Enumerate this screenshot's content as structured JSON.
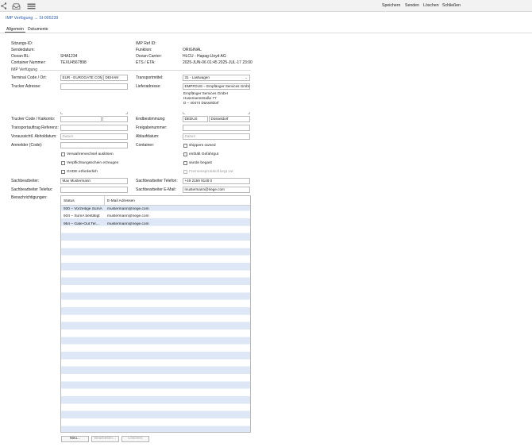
{
  "toolbar": {
    "actions": {
      "save": "Speichern",
      "send": "Senden",
      "delete": "Löschen",
      "close": "Schließen"
    }
  },
  "breadcrumb": "IMP Verfügung → SI-005239",
  "tabs": {
    "general": "Allgemein",
    "documents": "Dokumente"
  },
  "header_left": {
    "session_id_label": "Sitzungs-ID:",
    "send_date_label": "Sendedatum:",
    "ocean_bl_label": "Ocean BL:",
    "ocean_bl_value": "SHA1234",
    "container_no_label": "Container Nummer:",
    "container_no_value": "TEXU4567898"
  },
  "header_right": {
    "imp_ref_label": "IMP Ref ID:",
    "function_label": "Funktion:",
    "function_value": "ORIGINAL",
    "carrier_label": "Ocean Carrier:",
    "carrier_value": "HLCU - Hapag-Lloyd AG",
    "ets_label": "ETS / ETA:",
    "ets_value": "2025-JUN-06 01:45  2025-JUL-17 23:00"
  },
  "section_title": "IMP Verfügung",
  "form": {
    "terminal_label": "Terminal Code / Ort:",
    "terminal_code": "EUR - EUROGATE COM",
    "terminal_place": "DEHAM",
    "trucker_address_label": "Trucker Adresse:",
    "trucker_code_label": "Trucker Code / Kaikonto:",
    "transport_ref_label": "Transportauftrag Referenz:",
    "pickup_label": "Voraussichtl. Abholdatum:",
    "pickup_placeholder": "Datum",
    "notifier_label": "Anmelder (Code):",
    "transport_label": "Transportmittel:",
    "transport_value": "31 - Lastwagen",
    "delivery_label": "Lieferadresse:",
    "delivery_value": "EMPFDUS – Empfänger Services GmbH",
    "delivery_address": "Empfänger Services GmbH\nHusemannstraße 77\nD – 40474 Düsseldorf",
    "destination_label": "Endbestimmung:",
    "destination_code": "DEDUS",
    "destination_place": "Düsseldorf",
    "release_label": "Freigabenummer:",
    "expiry_label": "Ablaufdatum:",
    "expiry_placeholder": "Datum",
    "container_label": "Container:"
  },
  "checkboxes": {
    "custody_change": "Verwahrervechsel auslösen",
    "obligation": "Verpflichtungsschein erzeugen",
    "gvde": "GVDE erforderlich",
    "shipper_owned": "shippers owned",
    "dangerous": "enthält Gefahrgut",
    "fumigated": "wurde begast",
    "gas_free": "Freimessprotokoll liegt vor"
  },
  "clerk": {
    "name_label": "Sachbearbeiter:",
    "name_value": "Max Mustermann",
    "fax_label": "Sachbearbeiter Telefax:",
    "phone_label": "Sachbearbeiter Telefon:",
    "phone_value": "+49 2159 9148 0",
    "email_label": "Sachbearbeiter E-Mail:",
    "email_value": "mustermann@riege.com"
  },
  "notifications": {
    "label": "Benachrichtigungen:",
    "columns": [
      "Status",
      "E-Mail Adressen"
    ],
    "rows": [
      {
        "status": "930 – Vorzeitige SumA",
        "email": "mustermann@riege.com"
      },
      {
        "status": "934 – SumA bestätigt",
        "email": "mustermann@riege.com"
      },
      {
        "status": "954 – Gate-Out Ter...",
        "email": "mustermann@riege.com"
      }
    ]
  },
  "buttons": {
    "new": "Neu...",
    "edit": "Bearbeiten...",
    "delete": "Löschen"
  },
  "icons": [
    "share-icon",
    "inbox-icon",
    "list-menu-icon"
  ]
}
